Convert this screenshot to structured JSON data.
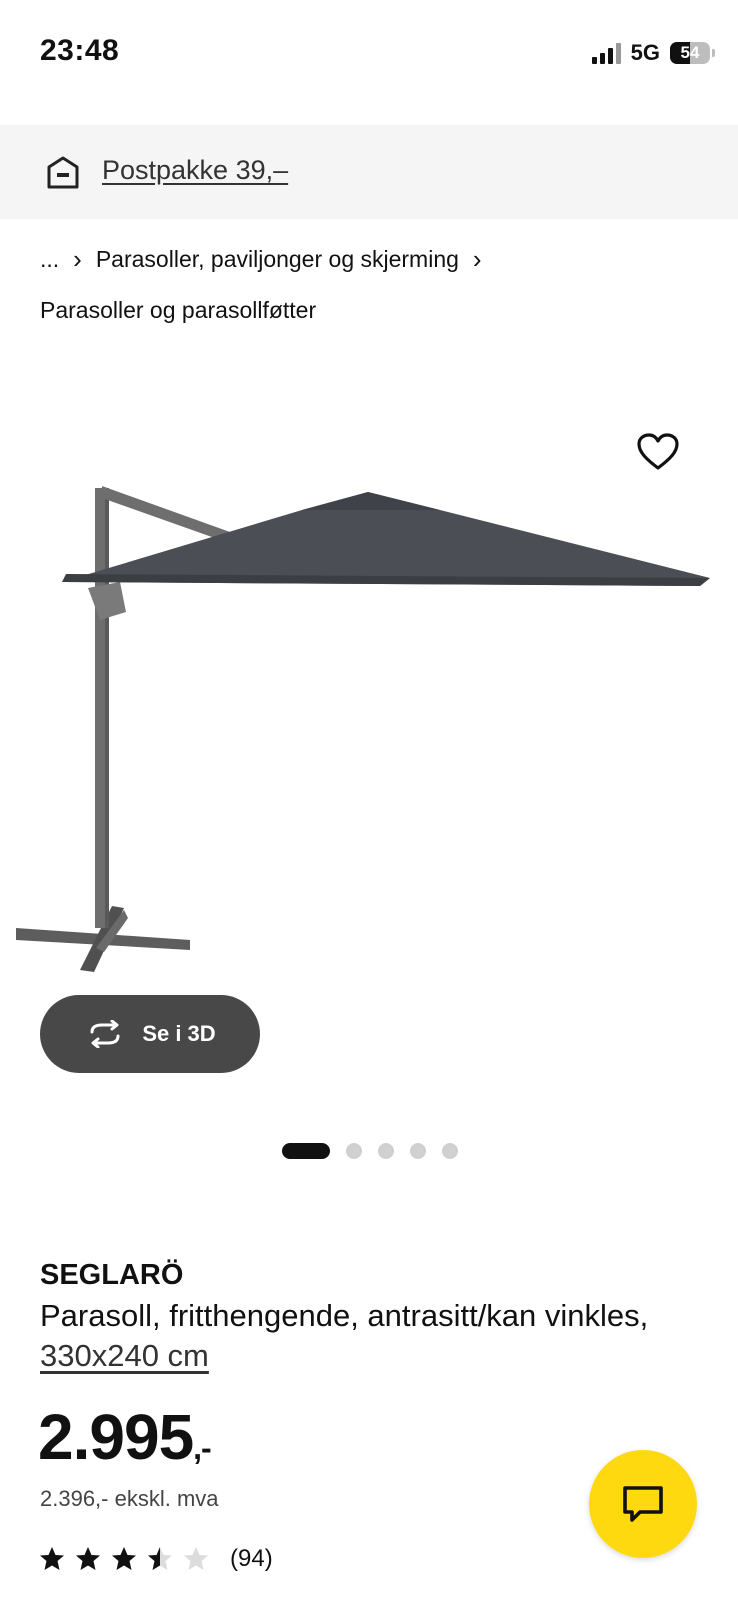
{
  "status": {
    "time": "23:48",
    "network": "5G",
    "battery": "54"
  },
  "delivery": {
    "label": "Postpakke 39,–",
    "icon": "delivery-box-icon"
  },
  "breadcrumb": {
    "ellipsis": "...",
    "category": "Parasoller, paviljonger og skjerming",
    "current": "Parasoller og parasollføtter"
  },
  "gallery": {
    "view3d_label": "Se i 3D",
    "image_count": 5,
    "active_index": 0
  },
  "product": {
    "brand": "SEGLARÖ",
    "description": "Parasoll, fritthengende, antrasitt/kan vinkles,",
    "size": "330x240 cm",
    "price": "2.995",
    "price_suffix": ",-",
    "price_ex_vat": "2.396,- ekskl. mva",
    "rating": 3.5,
    "review_count": "(94)"
  },
  "colors": {
    "chat_button": "#ffd90f",
    "view3d_button": "#484848",
    "delivery_bar": "#f5f5f5"
  }
}
